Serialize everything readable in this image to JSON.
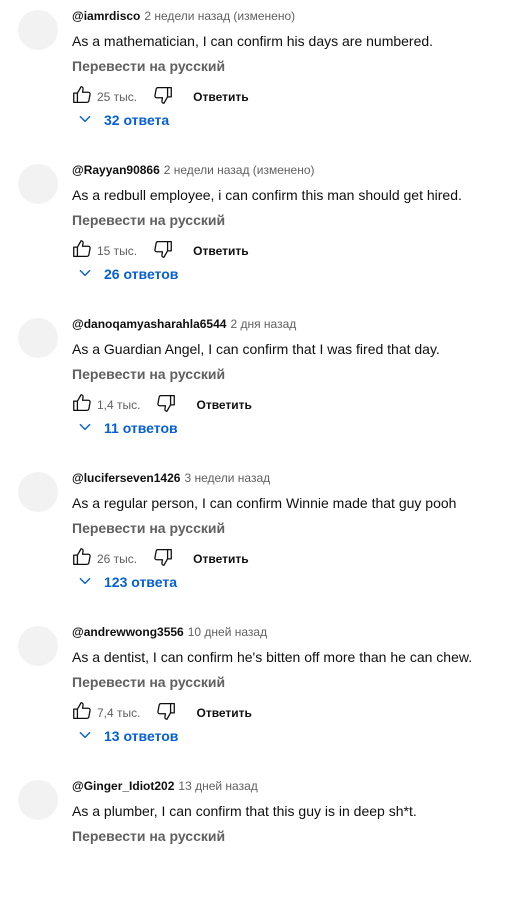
{
  "comments": [
    {
      "author": "@iamrdisco",
      "meta": "2 недели назад (изменено)",
      "text": "As a mathematician, I can confirm his days are numbered.",
      "translate": "Перевести на русский",
      "likes": "25 тыс.",
      "reply": "Ответить",
      "replies": "32 ответа"
    },
    {
      "author": "@Rayyan90866",
      "meta": "2 недели назад (изменено)",
      "text": "As a redbull employee, i can confirm this man should get hired.",
      "translate": "Перевести на русский",
      "likes": "15 тыс.",
      "reply": "Ответить",
      "replies": "26 ответов"
    },
    {
      "author": "@danoqamyasharahla6544",
      "meta": "2 дня назад",
      "text": "As a Guardian Angel, I can confirm that I was fired that day.",
      "translate": "Перевести на русский",
      "likes": "1,4 тыс.",
      "reply": "Ответить",
      "replies": "11 ответов"
    },
    {
      "author": "@luciferseven1426",
      "meta": "3 недели назад",
      "text": "As a regular person, I can confirm Winnie made that guy pooh",
      "translate": "Перевести на русский",
      "likes": "26 тыс.",
      "reply": "Ответить",
      "replies": "123 ответа"
    },
    {
      "author": "@andrewwong3556",
      "meta": "10 дней назад",
      "text": "As a dentist, I can confirm he's bitten off more than he can chew.",
      "translate": "Перевести на русский",
      "likes": "7,4 тыс.",
      "reply": "Ответить",
      "replies": "13 ответов"
    },
    {
      "author": "@Ginger_Idiot202",
      "meta": "13 дней назад",
      "text": "As a plumber, I can confirm that this guy is in deep sh*t.",
      "translate": "Перевести на русский"
    }
  ],
  "icons": {
    "like": "thumb-up-icon",
    "dislike": "thumb-down-icon",
    "expand": "chevron-down-icon"
  },
  "colors": {
    "link": "#065fd4",
    "secondary": "#606060",
    "avatar": "#f2f2f2"
  }
}
